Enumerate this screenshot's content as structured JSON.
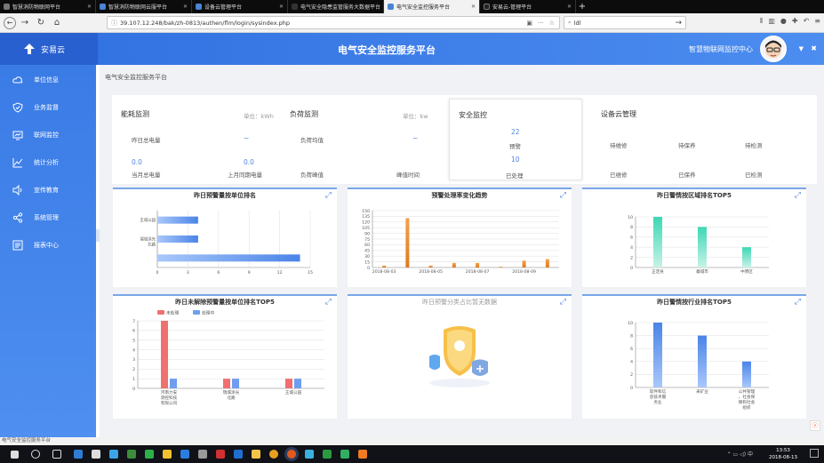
{
  "browser": {
    "tabs": [
      {
        "label": "智慧消防物联网平台",
        "active": false
      },
      {
        "label": "智慧消防物联网云服平台",
        "active": false
      },
      {
        "label": "设备云管理平台",
        "active": false
      },
      {
        "label": "电气安全隐患监管服务大数据平台",
        "active": false
      },
      {
        "label": "电气安全监控服务平台",
        "active": true
      },
      {
        "label": "安易云-管理平台",
        "active": false
      }
    ],
    "url": "39.107.12.248/bak/zh-0813/authen/flm/login/sysindex.php",
    "search": "ldl"
  },
  "header": {
    "logo": "安易云",
    "title": "电气安全监控服务平台",
    "org": "智慧物联网监控中心"
  },
  "sidebar": {
    "items": [
      {
        "label": "单位信息",
        "icon": "cloud-icon"
      },
      {
        "label": "业务监督",
        "icon": "shield-icon"
      },
      {
        "label": "联网监控",
        "icon": "monitor-icon"
      },
      {
        "label": "统计分析",
        "icon": "line-chart-icon"
      },
      {
        "label": "宣传教育",
        "icon": "speaker-icon"
      },
      {
        "label": "系统管理",
        "icon": "share-icon"
      },
      {
        "label": "报表中心",
        "icon": "report-icon"
      }
    ]
  },
  "breadcrumb": "电气安全监控服务平台",
  "energy": {
    "title": "能耗监测",
    "unit": "单位：kWh",
    "yesterday_label": "昨日总电量",
    "yesterday_value": "~",
    "v1": "0.0",
    "v2": "0.0",
    "month_label": "当月总电量",
    "last_label": "上月同期电量"
  },
  "load": {
    "title": "负荷监测",
    "unit": "单位：kw",
    "avg_label": "负荷均值",
    "avg_value": "~",
    "peak_label": "负荷峰值",
    "peak_time_label": "峰值时间"
  },
  "safety": {
    "title": "安全监控",
    "alarm_value": "22",
    "alarm_label": "预警",
    "handled_value": "10",
    "handled_label": "已处理"
  },
  "device": {
    "title": "设备云管理",
    "top": [
      "待维修",
      "待保养",
      "待检测"
    ],
    "bottom": [
      "已维修",
      "已保养",
      "已检测"
    ]
  },
  "panels": {
    "p1": "昨日预警量按单位排名",
    "p2": "预警处理率变化趋势",
    "p3": "昨日警情按区域排名TOP5",
    "p4": "昨日未解除预警量按单位排名TOP5",
    "p5": "昨日预警分类占比暂无数据",
    "p6": "昨日警情按行业排名TOP5"
  },
  "statusbar": "电气安全监控服务平台",
  "clock": {
    "time": "13:53",
    "date": "2018-08-13"
  },
  "colors": {
    "accent": "#4a84e8",
    "orange": "#f0913a",
    "teal": "#3dd0b0",
    "red": "#f07070"
  },
  "chart_data": [
    {
      "type": "bar",
      "orientation": "horizontal",
      "title": "昨日预警量按单位排名",
      "categories": [
        "王城公园",
        "瑞城涂光\n北路",
        ""
      ],
      "values": [
        4,
        4,
        14
      ],
      "xticks": [
        "0",
        "3",
        "6",
        "9",
        "12",
        "15"
      ],
      "xlim": [
        0,
        15
      ]
    },
    {
      "type": "bar",
      "title": "预警处理率变化趋势",
      "categories": [
        "2018-08-03",
        "",
        "2018-08-05",
        "",
        "2018-08-07",
        "",
        "2018-08-09",
        ""
      ],
      "xlabels": [
        "2018-08-03",
        "2018-08-05",
        "2018-08-07",
        "2018-08-09"
      ],
      "values": [
        5,
        130,
        5,
        12,
        12,
        2,
        18,
        22
      ],
      "yticks": [
        "0",
        "15",
        "30",
        "45",
        "60",
        "75",
        "90",
        "105",
        "120",
        "135",
        "150"
      ],
      "ylim": [
        0,
        150
      ]
    },
    {
      "type": "bar",
      "title": "昨日警情按区域排名TOP5",
      "categories": [
        "正定县",
        "藁城市",
        "中原区"
      ],
      "values": [
        10,
        8,
        4
      ],
      "yticks": [
        "0",
        "2",
        "4",
        "6",
        "8",
        "10"
      ],
      "ylim": [
        0,
        10
      ]
    },
    {
      "type": "bar",
      "title": "昨日未解除预警量按单位排名TOP5",
      "legend": [
        "未处理",
        "处理中"
      ],
      "categories": [
        "河南力安\n测控科技\n有限公司",
        "瑞城涂光\n北路",
        "王城公园"
      ],
      "series": [
        {
          "name": "未处理",
          "values": [
            7,
            1,
            1
          ]
        },
        {
          "name": "处理中",
          "values": [
            1,
            1,
            1
          ]
        }
      ],
      "yticks": [
        "0",
        "1",
        "2",
        "3",
        "4",
        "5",
        "6",
        "7"
      ],
      "ylim": [
        0,
        7
      ]
    },
    {
      "type": "bar",
      "title": "昨日警情按行业排名TOP5",
      "categories": [
        "软件和信\n息技术服\n务业",
        "采矿业",
        "公共管理\n、社会保\n障和社会\n组织"
      ],
      "values": [
        10,
        8,
        4
      ],
      "yticks": [
        "0",
        "2",
        "4",
        "6",
        "8",
        "10"
      ],
      "ylim": [
        0,
        10
      ]
    }
  ]
}
